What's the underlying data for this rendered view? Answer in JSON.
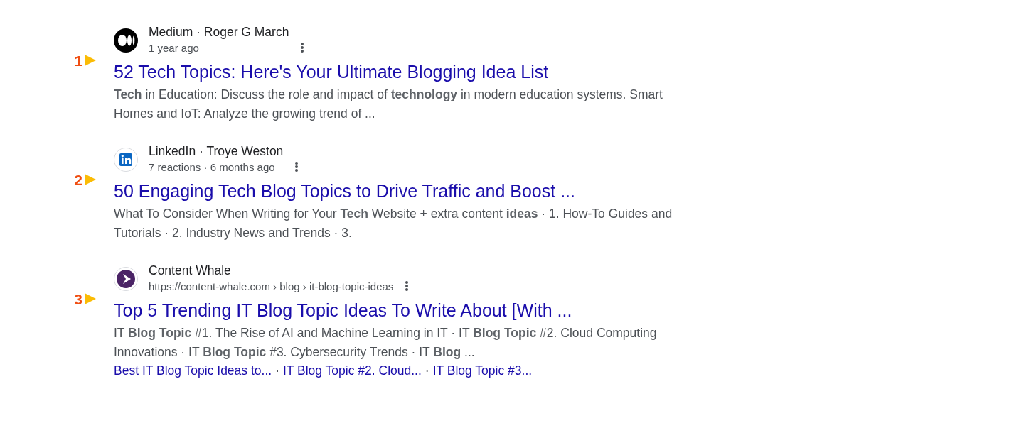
{
  "results": [
    {
      "marker": "1",
      "logo": {
        "kind": "medium"
      },
      "source": "Medium · Roger G March",
      "meta": "1 year ago",
      "title": "52 Tech Topics: Here's Your Ultimate Blogging Idea List",
      "snippet": "**Tech** in Education: Discuss the role and impact of **technology** in modern education systems. Smart Homes and IoT: Analyze the growing trend of ..."
    },
    {
      "marker": "2",
      "logo": {
        "kind": "linkedin"
      },
      "source": "LinkedIn · Troye Weston",
      "meta": "7 reactions · 6 months ago",
      "title": "50 Engaging Tech Blog Topics to Drive Traffic and Boost ...",
      "snippet": "What To Consider When Writing for Your **Tech** Website + extra content **ideas** · 1. How-To Guides and Tutorials · 2. Industry News and Trends · 3."
    },
    {
      "marker": "3",
      "logo": {
        "kind": "whale"
      },
      "source": "Content Whale",
      "meta": "https://content-whale.com › blog › it-blog-topic-ideas",
      "title": "Top 5 Trending IT Blog Topic Ideas To Write About [With ...",
      "snippet": "IT **Blog Topic** #1. The Rise of AI and Machine Learning in IT · IT **Blog Topic** #2. Cloud Computing Innovations · IT **Blog Topic** #3. Cybersecurity Trends · IT **Blog** ...",
      "sitelinks": [
        "Best IT Blog Topic Ideas to...",
        "IT Blog Topic #2. Cloud...",
        "IT Blog Topic #3..."
      ],
      "sitelink_separator": "·"
    }
  ]
}
